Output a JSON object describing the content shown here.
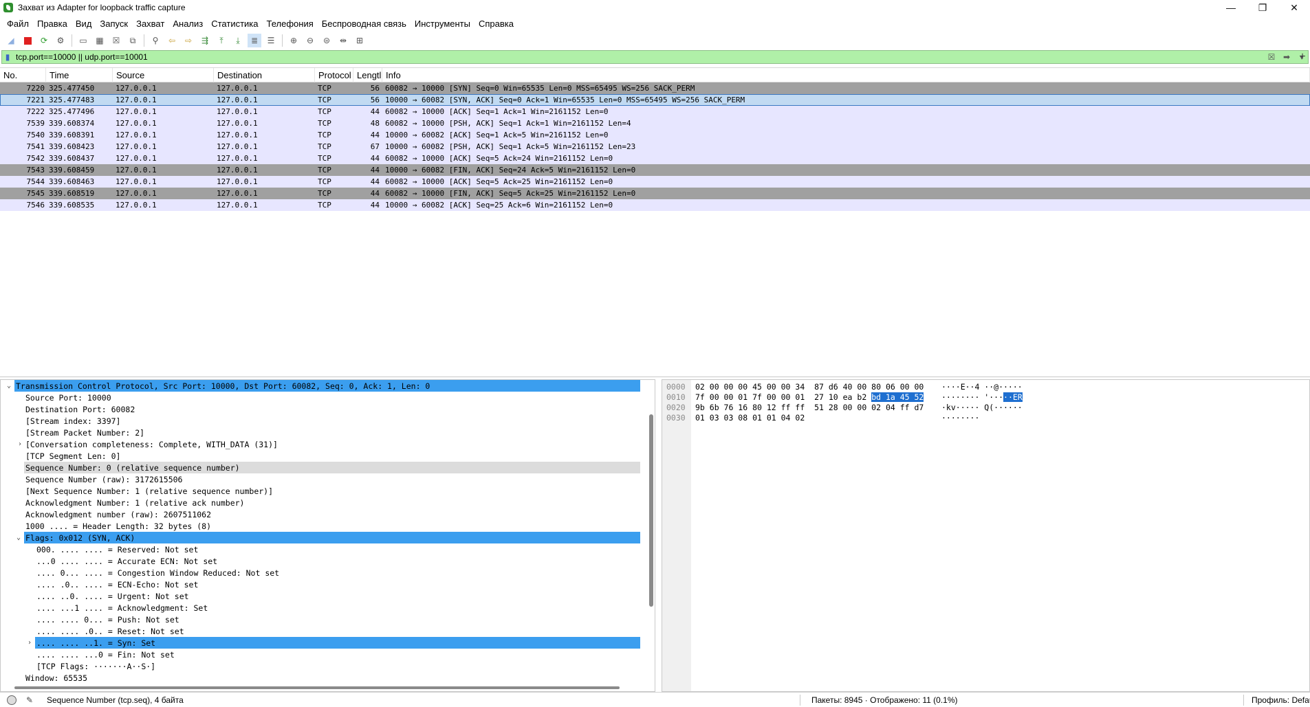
{
  "window": {
    "title": "Захват из Adapter for loopback traffic capture",
    "controls": [
      "—",
      "❐",
      "✕"
    ]
  },
  "menu": [
    "Файл",
    "Правка",
    "Вид",
    "Запуск",
    "Захват",
    "Анализ",
    "Статистика",
    "Телефония",
    "Беспроводная связь",
    "Инструменты",
    "Справка"
  ],
  "filter": {
    "value": "tcp.port==10000 || udp.port==10001"
  },
  "packet_list": {
    "columns": [
      "No.",
      "Time",
      "Source",
      "Destination",
      "Protocol",
      "Lengtl",
      "Info"
    ],
    "rows": [
      {
        "no": "7220",
        "time": "325.477450",
        "src": "127.0.0.1",
        "dst": "127.0.0.1",
        "proto": "TCP",
        "len": "56",
        "info": "60082 → 10000 [SYN] Seq=0 Win=65535 Len=0 MSS=65495 WS=256 SACK_PERM",
        "style": "gray"
      },
      {
        "no": "7221",
        "time": "325.477483",
        "src": "127.0.0.1",
        "dst": "127.0.0.1",
        "proto": "TCP",
        "len": "56",
        "info": "10000 → 60082 [SYN, ACK] Seq=0 Ack=1 Win=65535 Len=0 MSS=65495 WS=256 SACK_PERM",
        "style": "sel"
      },
      {
        "no": "7222",
        "time": "325.477496",
        "src": "127.0.0.1",
        "dst": "127.0.0.1",
        "proto": "TCP",
        "len": "44",
        "info": "60082 → 10000 [ACK] Seq=1 Ack=1 Win=2161152 Len=0",
        "style": "light"
      },
      {
        "no": "7539",
        "time": "339.608374",
        "src": "127.0.0.1",
        "dst": "127.0.0.1",
        "proto": "TCP",
        "len": "48",
        "info": "60082 → 10000 [PSH, ACK] Seq=1 Ack=1 Win=2161152 Len=4",
        "style": "light"
      },
      {
        "no": "7540",
        "time": "339.608391",
        "src": "127.0.0.1",
        "dst": "127.0.0.1",
        "proto": "TCP",
        "len": "44",
        "info": "10000 → 60082 [ACK] Seq=1 Ack=5 Win=2161152 Len=0",
        "style": "light"
      },
      {
        "no": "7541",
        "time": "339.608423",
        "src": "127.0.0.1",
        "dst": "127.0.0.1",
        "proto": "TCP",
        "len": "67",
        "info": "10000 → 60082 [PSH, ACK] Seq=1 Ack=5 Win=2161152 Len=23",
        "style": "light"
      },
      {
        "no": "7542",
        "time": "339.608437",
        "src": "127.0.0.1",
        "dst": "127.0.0.1",
        "proto": "TCP",
        "len": "44",
        "info": "60082 → 10000 [ACK] Seq=5 Ack=24 Win=2161152 Len=0",
        "style": "light"
      },
      {
        "no": "7543",
        "time": "339.608459",
        "src": "127.0.0.1",
        "dst": "127.0.0.1",
        "proto": "TCP",
        "len": "44",
        "info": "10000 → 60082 [FIN, ACK] Seq=24 Ack=5 Win=2161152 Len=0",
        "style": "gray"
      },
      {
        "no": "7544",
        "time": "339.608463",
        "src": "127.0.0.1",
        "dst": "127.0.0.1",
        "proto": "TCP",
        "len": "44",
        "info": "60082 → 10000 [ACK] Seq=5 Ack=25 Win=2161152 Len=0",
        "style": "light"
      },
      {
        "no": "7545",
        "time": "339.608519",
        "src": "127.0.0.1",
        "dst": "127.0.0.1",
        "proto": "TCP",
        "len": "44",
        "info": "60082 → 10000 [FIN, ACK] Seq=5 Ack=25 Win=2161152 Len=0",
        "style": "gray"
      },
      {
        "no": "7546",
        "time": "339.608535",
        "src": "127.0.0.1",
        "dst": "127.0.0.1",
        "proto": "TCP",
        "len": "44",
        "info": "10000 → 60082 [ACK] Seq=25 Ack=6 Win=2161152 Len=0",
        "style": "light"
      }
    ]
  },
  "details": [
    {
      "text": "Transmission Control Protocol, Src Port: 10000, Dst Port: 60082, Seq: 0, Ack: 1, Len: 0",
      "depth": 0,
      "exp": "v",
      "style": "sel"
    },
    {
      "text": "Source Port: 10000",
      "depth": 1,
      "exp": "",
      "style": ""
    },
    {
      "text": "Destination Port: 60082",
      "depth": 1,
      "exp": "",
      "style": ""
    },
    {
      "text": "[Stream index: 3397]",
      "depth": 1,
      "exp": "",
      "style": ""
    },
    {
      "text": "[Stream Packet Number: 2]",
      "depth": 1,
      "exp": "",
      "style": ""
    },
    {
      "text": "[Conversation completeness: Complete, WITH_DATA (31)]",
      "depth": 1,
      "exp": ">",
      "style": ""
    },
    {
      "text": "[TCP Segment Len: 0]",
      "depth": 1,
      "exp": "",
      "style": ""
    },
    {
      "text": "Sequence Number: 0    (relative sequence number)",
      "depth": 1,
      "exp": "",
      "style": "hl"
    },
    {
      "text": "Sequence Number (raw): 3172615506",
      "depth": 1,
      "exp": "",
      "style": ""
    },
    {
      "text": "[Next Sequence Number: 1    (relative sequence number)]",
      "depth": 1,
      "exp": "",
      "style": ""
    },
    {
      "text": "Acknowledgment Number: 1    (relative ack number)",
      "depth": 1,
      "exp": "",
      "style": ""
    },
    {
      "text": "Acknowledgment number (raw): 2607511062",
      "depth": 1,
      "exp": "",
      "style": ""
    },
    {
      "text": "1000 .... = Header Length: 32 bytes (8)",
      "depth": 1,
      "exp": "",
      "style": ""
    },
    {
      "text": "Flags: 0x012 (SYN, ACK)",
      "depth": 1,
      "exp": "v",
      "style": "sel"
    },
    {
      "text": "000. .... .... = Reserved: Not set",
      "depth": 2,
      "exp": "",
      "style": ""
    },
    {
      "text": "...0 .... .... = Accurate ECN: Not set",
      "depth": 2,
      "exp": "",
      "style": ""
    },
    {
      "text": ".... 0... .... = Congestion Window Reduced: Not set",
      "depth": 2,
      "exp": "",
      "style": ""
    },
    {
      "text": ".... .0.. .... = ECN-Echo: Not set",
      "depth": 2,
      "exp": "",
      "style": ""
    },
    {
      "text": ".... ..0. .... = Urgent: Not set",
      "depth": 2,
      "exp": "",
      "style": ""
    },
    {
      "text": ".... ...1 .... = Acknowledgment: Set",
      "depth": 2,
      "exp": "",
      "style": ""
    },
    {
      "text": ".... .... 0... = Push: Not set",
      "depth": 2,
      "exp": "",
      "style": ""
    },
    {
      "text": ".... .... .0.. = Reset: Not set",
      "depth": 2,
      "exp": "",
      "style": ""
    },
    {
      "text": ".... .... ..1. = Syn: Set",
      "depth": 2,
      "exp": ">",
      "style": "sel"
    },
    {
      "text": ".... .... ...0 = Fin: Not set",
      "depth": 2,
      "exp": "",
      "style": ""
    },
    {
      "text": "[TCP Flags: ·······A··S·]",
      "depth": 2,
      "exp": "",
      "style": ""
    },
    {
      "text": "Window: 65535",
      "depth": 1,
      "exp": "",
      "style": ""
    }
  ],
  "hex": {
    "offsets": [
      "0000",
      "0010",
      "0020",
      "0030"
    ],
    "rows": [
      {
        "pre": "02 00 00 00 45 00 00 34  87 d6 40 00 80 06 00 00",
        "sel": "",
        "post": "",
        "a_pre": "····E··4 ··@·····",
        "a_sel": "",
        "a_post": ""
      },
      {
        "pre": "7f 00 00 01 7f 00 00 01  27 10 ea b2 ",
        "sel": "bd 1a 45 52",
        "post": "",
        "a_pre": "········ '···",
        "a_sel": "··ER",
        "a_post": ""
      },
      {
        "pre": "9b 6b 76 16 80 12 ff ff  51 28 00 00 02 04 ff d7",
        "sel": "",
        "post": "",
        "a_pre": "·kv····· Q(······",
        "a_sel": "",
        "a_post": ""
      },
      {
        "pre": "01 03 03 08 01 01 04 02",
        "sel": "",
        "post": "",
        "a_pre": "········",
        "a_sel": "",
        "a_post": ""
      }
    ]
  },
  "status": {
    "field": "Sequence Number (tcp.seq), 4 байта",
    "packets": "Пакеты: 8945 · Отображено: 11 (0.1%)",
    "profile": "Профиль: Default"
  },
  "colors": {
    "filter_bg": "#b0f0a8",
    "row_light": "#e7e6ff",
    "row_gray": "#a0a0a0",
    "selection": "#3b9eef",
    "hex_selection": "#1e6fd0"
  }
}
